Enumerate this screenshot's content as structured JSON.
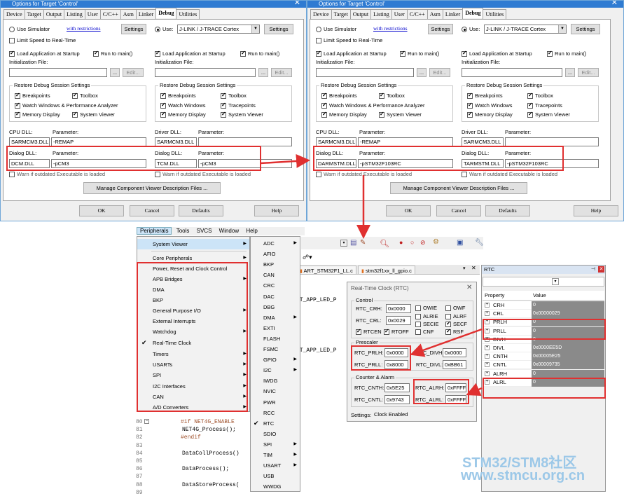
{
  "dialog_title": "Options for Target 'Control'",
  "tabs": [
    "Device",
    "Target",
    "Output",
    "Listing",
    "User",
    "C/C++",
    "Asm",
    "Linker",
    "Debug",
    "Utilities"
  ],
  "left_side": {
    "use_simulator": "Use Simulator",
    "with_restrictions": "with restrictions",
    "settings": "Settings",
    "limit_speed": "Limit Speed to Real-Time",
    "load_app": "Load Application at Startup",
    "run_main": "Run to main()",
    "init_file": "Initialization File:",
    "edit": "Edit...",
    "browse": "...",
    "restore_group": "Restore Debug Session Settings",
    "breakpoints": "Breakpoints",
    "toolbox": "Toolbox",
    "watch_windows": "Watch Windows & Performance Analyzer",
    "memory_display": "Memory Display",
    "system_viewer": "System Viewer",
    "cpu_dll": "CPU DLL:",
    "parameter": "Parameter:",
    "dialog_dll": "Dialog DLL:",
    "warn": "Warn if outdated Executable is loaded"
  },
  "right_side": {
    "use": "Use:",
    "driver": "J-LINK / J-TRACE Cortex",
    "settings": "Settings",
    "load_app": "Load Application at Startup",
    "run_main": "Run to main()",
    "init_file": "Initialization File:",
    "edit": "Edit...",
    "browse": "...",
    "restore_group": "Restore Debug Session Settings",
    "breakpoints": "Breakpoints",
    "toolbox": "Toolbox",
    "watch_windows": "Watch Windows",
    "tracepoints": "Tracepoints",
    "memory_display": "Memory Display",
    "system_viewer": "System Viewer",
    "driver_dll": "Driver DLL:",
    "parameter": "Parameter:",
    "dialog_dll": "Dialog DLL:",
    "warn": "Warn if outdated Executable is loaded"
  },
  "dlg1": {
    "cpu_dll": "SARMCM3.DLL",
    "cpu_param": "-REMAP",
    "dialog_dll": "DCM.DLL",
    "dialog_param": "-pCM3",
    "driver_dll": "SARMCM3.DLL",
    "driver_param": "",
    "t_dialog_dll": "TCM.DLL",
    "t_dialog_param": "-pCM3"
  },
  "dlg2": {
    "cpu_dll": "SARMCM3.DLL",
    "cpu_param": "-REMAP",
    "dialog_dll": "DARMSTM.DLL",
    "dialog_param": "-pSTM32F103RC",
    "driver_dll": "SARMCM3.DLL",
    "driver_param": "",
    "t_dialog_dll": "TARMSTM.DLL",
    "t_dialog_param": "-pSTM32F103RC"
  },
  "manage_btn": "Manage Component Viewer Description Files ...",
  "ok": "OK",
  "cancel": "Cancel",
  "defaults": "Defaults",
  "help": "Help",
  "menubar": [
    "Peripherals",
    "Tools",
    "SVCS",
    "Window",
    "Help"
  ],
  "periph_menu": [
    {
      "label": "System Viewer",
      "sub": true
    },
    {
      "label": "Core Peripherals",
      "sub": true
    },
    {
      "label": "Power, Reset and Clock Control",
      "sub": false
    },
    {
      "label": "APB Bridges",
      "sub": true
    },
    {
      "label": "DMA",
      "sub": false
    },
    {
      "label": "BKP",
      "sub": false
    },
    {
      "label": "General Purpose I/O",
      "sub": true
    },
    {
      "label": "External Interrupts",
      "sub": false
    },
    {
      "label": "Watchdog",
      "sub": true
    },
    {
      "label": "Real-Time Clock",
      "sub": false,
      "checked": true
    },
    {
      "label": "Timers",
      "sub": true
    },
    {
      "label": "USARTs",
      "sub": true
    },
    {
      "label": "SPI",
      "sub": true
    },
    {
      "label": "I2C Interfaces",
      "sub": true
    },
    {
      "label": "CAN",
      "sub": true
    },
    {
      "label": "A/D Converters",
      "sub": true
    }
  ],
  "sysview_menu": [
    {
      "label": "ADC",
      "sub": true
    },
    {
      "label": "AFIO",
      "sub": false
    },
    {
      "label": "BKP",
      "sub": false
    },
    {
      "label": "CAN",
      "sub": false
    },
    {
      "label": "CRC",
      "sub": false
    },
    {
      "label": "DAC",
      "sub": false
    },
    {
      "label": "DBG",
      "sub": false
    },
    {
      "label": "DMA",
      "sub": true
    },
    {
      "label": "EXTI",
      "sub": false
    },
    {
      "label": "FLASH",
      "sub": false
    },
    {
      "label": "FSMC",
      "sub": false
    },
    {
      "label": "GPIO",
      "sub": true
    },
    {
      "label": "I2C",
      "sub": true
    },
    {
      "label": "IWDG",
      "sub": false
    },
    {
      "label": "NVIC",
      "sub": false
    },
    {
      "label": "PWR",
      "sub": false
    },
    {
      "label": "RCC",
      "sub": false
    },
    {
      "label": "RTC",
      "sub": false,
      "checked": true
    },
    {
      "label": "SDIO",
      "sub": false
    },
    {
      "label": "SPI",
      "sub": true
    },
    {
      "label": "TIM",
      "sub": true
    },
    {
      "label": "USART",
      "sub": true
    },
    {
      "label": "USB",
      "sub": false
    },
    {
      "label": "WWDG",
      "sub": false
    }
  ],
  "editor_tabs": [
    "ART_STM32F1_LL.c",
    "stm32f1xx_ll_gpio.c"
  ],
  "code_lines": [
    {
      "n": "80",
      "t": "#if NET4G_ENABLE"
    },
    {
      "n": "81",
      "t": "NET4G_Process();"
    },
    {
      "n": "82",
      "t": "#endif"
    },
    {
      "n": "83",
      "t": ""
    },
    {
      "n": "84",
      "t": "DataCollProcess()"
    },
    {
      "n": "85",
      "t": ""
    },
    {
      "n": "86",
      "t": "DataProcess();"
    },
    {
      "n": "87",
      "t": ""
    },
    {
      "n": "88",
      "t": "DataStoreProcess("
    },
    {
      "n": "89",
      "t": ""
    }
  ],
  "code_frag1": "LT_APP_LED_P",
  "code_frag2": "LT_APP_LED_P",
  "rtc_dialog": {
    "title": "Real-Time Clock (RTC)",
    "control": "Control",
    "rtc_crh_l": "RTC_CRH:",
    "rtc_crh": "0x0000",
    "rtc_crl_l": "RTC_CRL:",
    "rtc_crl": "0x0029",
    "owie": "OWIE",
    "owf": "OWF",
    "alrie": "ALRIE",
    "alrf": "ALRF",
    "secie": "SECIE",
    "secf": "SECF",
    "rtcen": "RTCEN",
    "rtoff": "RTOFF",
    "cnf": "CNF",
    "rsf": "RSF",
    "prescaler": "Prescaler",
    "prlh_l": "RTC_PRLH:",
    "prlh": "0x0000",
    "divh_l": "RTC_DIVH:",
    "divh": "0x0000",
    "prll_l": "RTC_PRLL:",
    "prll": "0x8000",
    "divl_l": "RTC_DIVL:",
    "divl": "0xBB61",
    "counter": "Counter & Alarm",
    "cnth_l": "RTC_CNTH:",
    "cnth": "0x5E25",
    "alrh_l": "RTC_ALRH:",
    "alrh": "0xFFFF",
    "cntl_l": "RTC_CNTL:",
    "cntl": "0x9743",
    "alrl_l": "RTC_ALRL:",
    "alrl": "0xFFFF",
    "settings_l": "Settings:",
    "settings": "Clock Enabled"
  },
  "rtc_panel": {
    "title": "RTC",
    "col_property": "Property",
    "col_value": "Value",
    "rows": [
      {
        "p": "CRH",
        "v": "0"
      },
      {
        "p": "CRL",
        "v": "0x00000029"
      },
      {
        "p": "PRLH",
        "v": "0"
      },
      {
        "p": "PRLL",
        "v": "0"
      },
      {
        "p": "DIVH",
        "v": "0"
      },
      {
        "p": "DIVL",
        "v": "0x0000EE5D"
      },
      {
        "p": "CNTH",
        "v": "0x00005E25"
      },
      {
        "p": "CNTL",
        "v": "0x00009735"
      },
      {
        "p": "ALRH",
        "v": "0"
      },
      {
        "p": "ALRL",
        "v": "0"
      }
    ]
  },
  "watermark1": "STM32/STM8社区",
  "watermark2": "www.stmcu.org.cn",
  "colors": {
    "red": "#e03030",
    "title_blue": "#2f7bd2",
    "panel_value_bg": "#8a8a8a"
  }
}
